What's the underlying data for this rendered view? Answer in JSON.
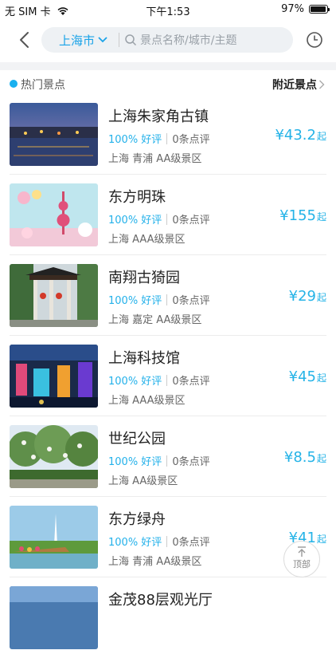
{
  "status": {
    "carrier": "无 SIM 卡",
    "time": "下午1:53",
    "battery": "97%",
    "battery_level": 0.97
  },
  "nav": {
    "city": "上海市",
    "search_placeholder": "景点名称/城市/主题"
  },
  "section": {
    "title": "热门景点",
    "nearby_label": "附近景点"
  },
  "items": [
    {
      "name": "上海朱家角古镇",
      "good": "100% 好评",
      "reviews": "0条点评",
      "location": "上海 青浦 AA级景区",
      "price": "¥43.2",
      "unit": "起"
    },
    {
      "name": "东方明珠",
      "good": "100% 好评",
      "reviews": "0条点评",
      "location": "上海 AAA级景区",
      "price": "¥155",
      "unit": "起"
    },
    {
      "name": "南翔古猗园",
      "good": "100% 好评",
      "reviews": "0条点评",
      "location": "上海 嘉定 AA级景区",
      "price": "¥29",
      "unit": "起"
    },
    {
      "name": "上海科技馆",
      "good": "100% 好评",
      "reviews": "0条点评",
      "location": "上海 AAA级景区",
      "price": "¥45",
      "unit": "起"
    },
    {
      "name": "世纪公园",
      "good": "100% 好评",
      "reviews": "0条点评",
      "location": "上海 AA级景区",
      "price": "¥8.5",
      "unit": "起"
    },
    {
      "name": "东方绿舟",
      "good": "100% 好评",
      "reviews": "0条点评",
      "location": "上海 青浦 AA级景区",
      "price": "¥41",
      "unit": "起"
    },
    {
      "name": "金茂88层观光厅"
    }
  ],
  "back_to_top": "顶部",
  "colors": {
    "accent": "#1aa3e8",
    "price": "#25b3e7"
  }
}
